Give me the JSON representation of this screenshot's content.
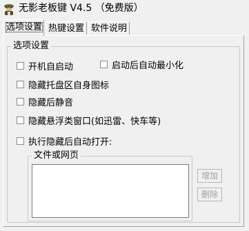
{
  "window": {
    "title": "无影老板键 V4.5 （免费版）",
    "icon": "boss-key-app-icon"
  },
  "tabs": [
    {
      "label": "选项设置",
      "active": true
    },
    {
      "label": "热键设置",
      "active": false
    },
    {
      "label": "软件说明",
      "active": false
    }
  ],
  "options_group": {
    "legend": "选项设置",
    "checkboxes": [
      {
        "label": "开机自启动",
        "checked": false
      },
      {
        "label": "启动后自动最小化",
        "checked": false
      },
      {
        "label": "隐藏托盘区自身图标",
        "checked": false
      },
      {
        "label": "隐藏后静音",
        "checked": false
      },
      {
        "label": "隐藏悬浮类窗口(如迅雷、快车等)",
        "checked": false
      },
      {
        "label": "执行隐藏后自动打开:",
        "checked": false
      }
    ]
  },
  "file_group": {
    "legend": "文件或网页",
    "value": ""
  },
  "buttons": {
    "add_label": "增加",
    "delete_label": "删除"
  }
}
